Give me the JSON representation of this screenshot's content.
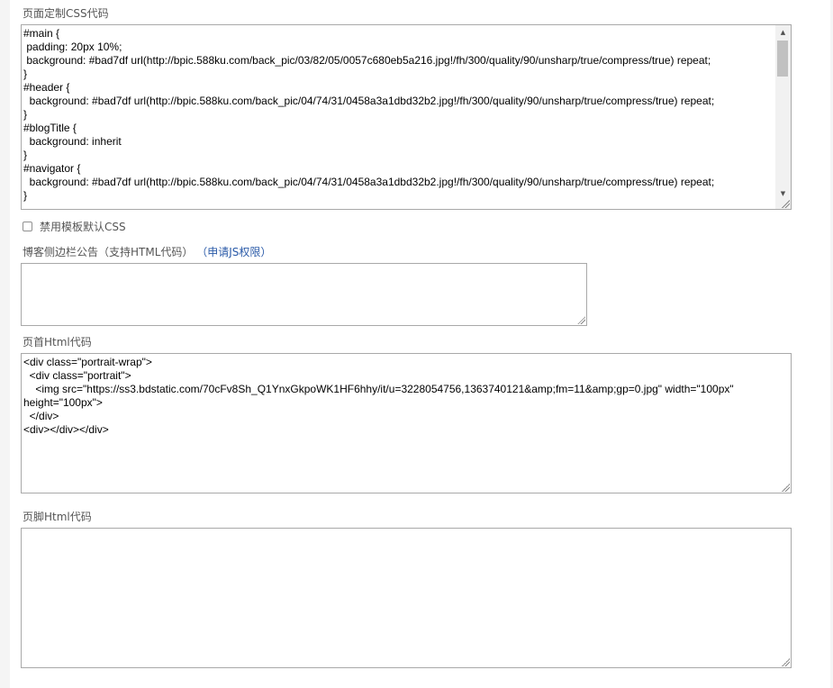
{
  "css_section": {
    "label": "页面定制CSS代码",
    "value": "#main {\n padding: 20px 10%;\n background: #bad7df url(http://bpic.588ku.com/back_pic/03/82/05/0057c680eb5a216.jpg!/fh/300/quality/90/unsharp/true/compress/true) repeat;\n}\n#header {\n  background: #bad7df url(http://bpic.588ku.com/back_pic/04/74/31/0458a3a1dbd32b2.jpg!/fh/300/quality/90/unsharp/true/compress/true) repeat;\n}\n#blogTitle {\n  background: inherit\n}\n#navigator {\n  background: #bad7df url(http://bpic.588ku.com/back_pic/04/74/31/0458a3a1dbd32b2.jpg!/fh/300/quality/90/unsharp/true/compress/true) repeat;\n}"
  },
  "disable_default_css": {
    "label": "禁用模板默认CSS",
    "checked": false
  },
  "sidebar_notice": {
    "label": "博客侧边栏公告（支持HTML代码）",
    "link_label": "（申请JS权限）",
    "value": ""
  },
  "header_html": {
    "label": "页首Html代码",
    "value": "<div class=\"portrait-wrap\">\n  <div class=\"portrait\">\n    <img src=\"https://ss3.bdstatic.com/70cFv8Sh_Q1YnxGkpoWK1HF6hhy/it/u=3228054756,1363740121&amp;fm=11&amp;gp=0.jpg\" width=\"100px\" height=\"100px\">\n  </div>\n<div></div></div>"
  },
  "footer_html": {
    "label": "页脚Html代码",
    "value": ""
  }
}
